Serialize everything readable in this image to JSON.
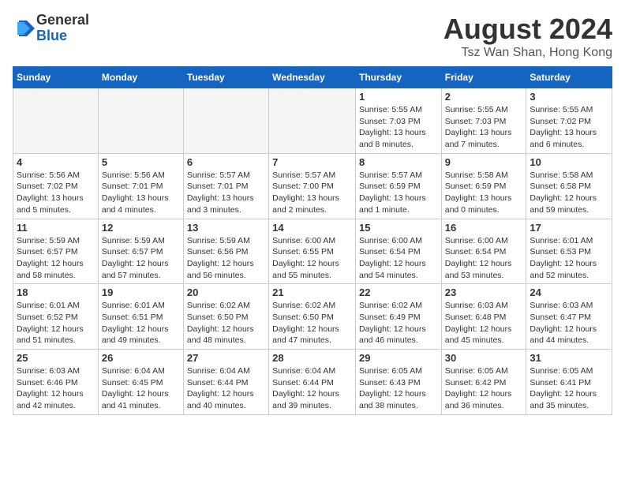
{
  "header": {
    "logo_line1": "General",
    "logo_line2": "Blue",
    "month_year": "August 2024",
    "location": "Tsz Wan Shan, Hong Kong"
  },
  "weekdays": [
    "Sunday",
    "Monday",
    "Tuesday",
    "Wednesday",
    "Thursday",
    "Friday",
    "Saturday"
  ],
  "weeks": [
    [
      {
        "day": "",
        "text": "",
        "empty": true
      },
      {
        "day": "",
        "text": "",
        "empty": true
      },
      {
        "day": "",
        "text": "",
        "empty": true
      },
      {
        "day": "",
        "text": "",
        "empty": true
      },
      {
        "day": "1",
        "text": "Sunrise: 5:55 AM\nSunset: 7:03 PM\nDaylight: 13 hours\nand 8 minutes."
      },
      {
        "day": "2",
        "text": "Sunrise: 5:55 AM\nSunset: 7:03 PM\nDaylight: 13 hours\nand 7 minutes."
      },
      {
        "day": "3",
        "text": "Sunrise: 5:55 AM\nSunset: 7:02 PM\nDaylight: 13 hours\nand 6 minutes."
      }
    ],
    [
      {
        "day": "4",
        "text": "Sunrise: 5:56 AM\nSunset: 7:02 PM\nDaylight: 13 hours\nand 5 minutes."
      },
      {
        "day": "5",
        "text": "Sunrise: 5:56 AM\nSunset: 7:01 PM\nDaylight: 13 hours\nand 4 minutes."
      },
      {
        "day": "6",
        "text": "Sunrise: 5:57 AM\nSunset: 7:01 PM\nDaylight: 13 hours\nand 3 minutes."
      },
      {
        "day": "7",
        "text": "Sunrise: 5:57 AM\nSunset: 7:00 PM\nDaylight: 13 hours\nand 2 minutes."
      },
      {
        "day": "8",
        "text": "Sunrise: 5:57 AM\nSunset: 6:59 PM\nDaylight: 13 hours\nand 1 minute."
      },
      {
        "day": "9",
        "text": "Sunrise: 5:58 AM\nSunset: 6:59 PM\nDaylight: 13 hours\nand 0 minutes."
      },
      {
        "day": "10",
        "text": "Sunrise: 5:58 AM\nSunset: 6:58 PM\nDaylight: 12 hours\nand 59 minutes."
      }
    ],
    [
      {
        "day": "11",
        "text": "Sunrise: 5:59 AM\nSunset: 6:57 PM\nDaylight: 12 hours\nand 58 minutes."
      },
      {
        "day": "12",
        "text": "Sunrise: 5:59 AM\nSunset: 6:57 PM\nDaylight: 12 hours\nand 57 minutes."
      },
      {
        "day": "13",
        "text": "Sunrise: 5:59 AM\nSunset: 6:56 PM\nDaylight: 12 hours\nand 56 minutes."
      },
      {
        "day": "14",
        "text": "Sunrise: 6:00 AM\nSunset: 6:55 PM\nDaylight: 12 hours\nand 55 minutes."
      },
      {
        "day": "15",
        "text": "Sunrise: 6:00 AM\nSunset: 6:54 PM\nDaylight: 12 hours\nand 54 minutes."
      },
      {
        "day": "16",
        "text": "Sunrise: 6:00 AM\nSunset: 6:54 PM\nDaylight: 12 hours\nand 53 minutes."
      },
      {
        "day": "17",
        "text": "Sunrise: 6:01 AM\nSunset: 6:53 PM\nDaylight: 12 hours\nand 52 minutes."
      }
    ],
    [
      {
        "day": "18",
        "text": "Sunrise: 6:01 AM\nSunset: 6:52 PM\nDaylight: 12 hours\nand 51 minutes."
      },
      {
        "day": "19",
        "text": "Sunrise: 6:01 AM\nSunset: 6:51 PM\nDaylight: 12 hours\nand 49 minutes."
      },
      {
        "day": "20",
        "text": "Sunrise: 6:02 AM\nSunset: 6:50 PM\nDaylight: 12 hours\nand 48 minutes."
      },
      {
        "day": "21",
        "text": "Sunrise: 6:02 AM\nSunset: 6:50 PM\nDaylight: 12 hours\nand 47 minutes."
      },
      {
        "day": "22",
        "text": "Sunrise: 6:02 AM\nSunset: 6:49 PM\nDaylight: 12 hours\nand 46 minutes."
      },
      {
        "day": "23",
        "text": "Sunrise: 6:03 AM\nSunset: 6:48 PM\nDaylight: 12 hours\nand 45 minutes."
      },
      {
        "day": "24",
        "text": "Sunrise: 6:03 AM\nSunset: 6:47 PM\nDaylight: 12 hours\nand 44 minutes."
      }
    ],
    [
      {
        "day": "25",
        "text": "Sunrise: 6:03 AM\nSunset: 6:46 PM\nDaylight: 12 hours\nand 42 minutes."
      },
      {
        "day": "26",
        "text": "Sunrise: 6:04 AM\nSunset: 6:45 PM\nDaylight: 12 hours\nand 41 minutes."
      },
      {
        "day": "27",
        "text": "Sunrise: 6:04 AM\nSunset: 6:44 PM\nDaylight: 12 hours\nand 40 minutes."
      },
      {
        "day": "28",
        "text": "Sunrise: 6:04 AM\nSunset: 6:44 PM\nDaylight: 12 hours\nand 39 minutes."
      },
      {
        "day": "29",
        "text": "Sunrise: 6:05 AM\nSunset: 6:43 PM\nDaylight: 12 hours\nand 38 minutes."
      },
      {
        "day": "30",
        "text": "Sunrise: 6:05 AM\nSunset: 6:42 PM\nDaylight: 12 hours\nand 36 minutes."
      },
      {
        "day": "31",
        "text": "Sunrise: 6:05 AM\nSunset: 6:41 PM\nDaylight: 12 hours\nand 35 minutes."
      }
    ]
  ]
}
